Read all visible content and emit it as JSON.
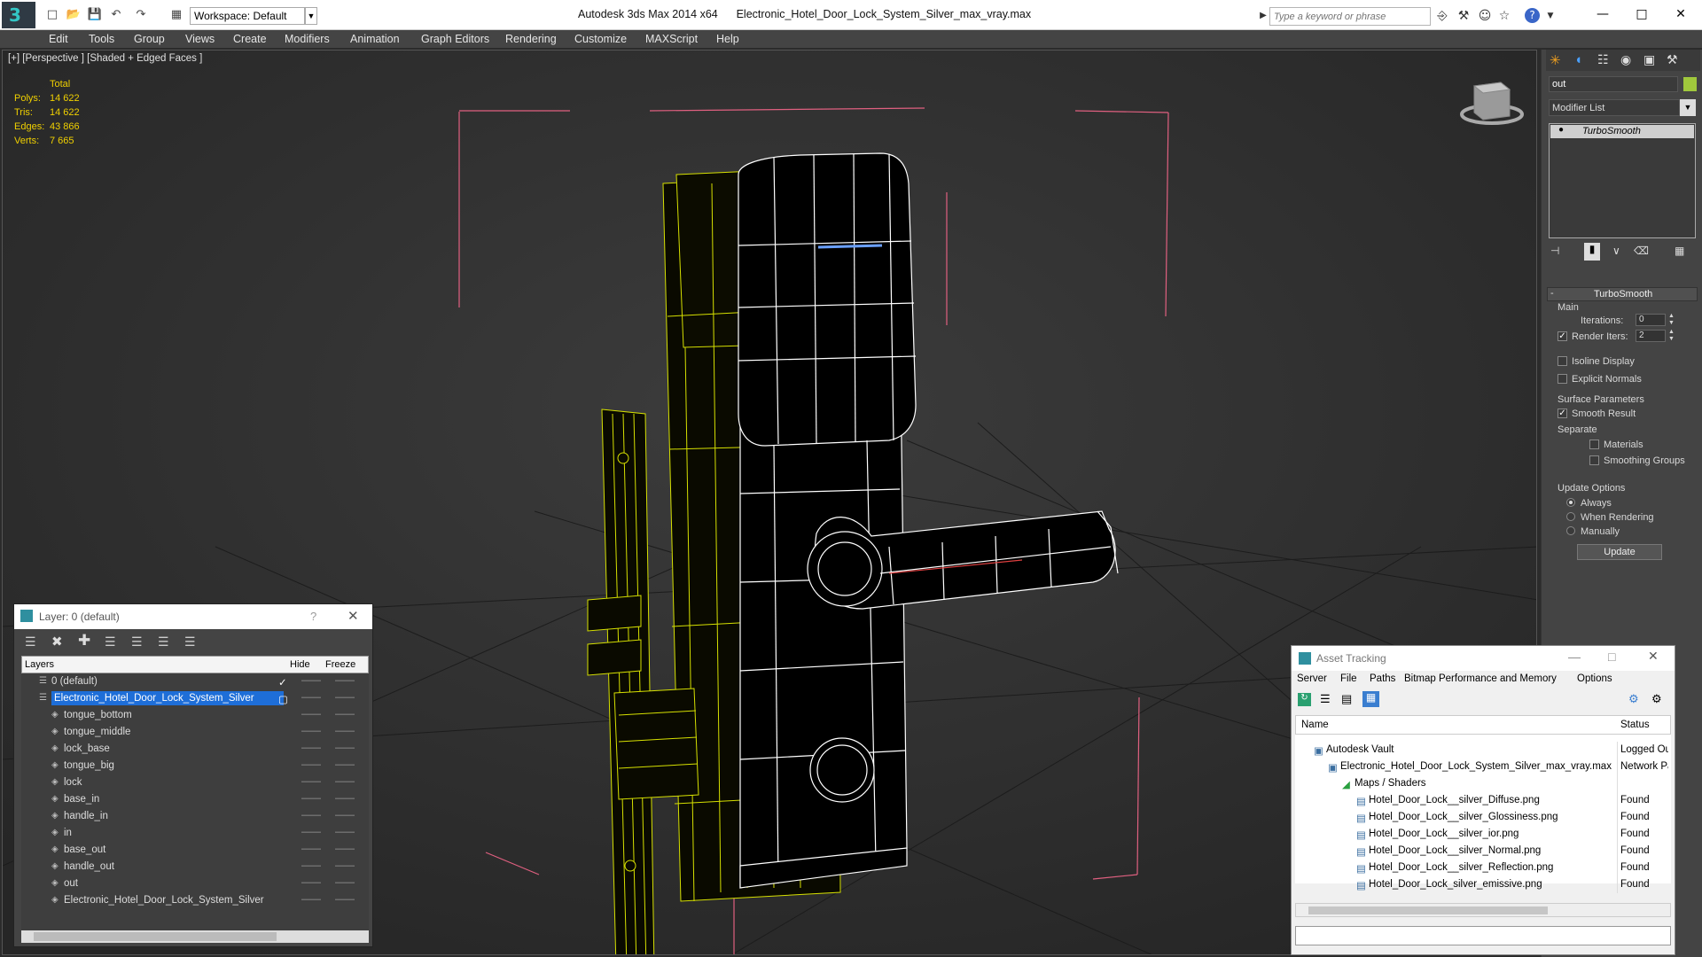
{
  "titlebar": {
    "app_title": "Autodesk 3ds Max  2014 x64",
    "file_title": "Electronic_Hotel_Door_Lock_System_Silver_max_vray.max",
    "workspace_label": "Workspace: Default",
    "search_placeholder": "Type a keyword or phrase",
    "help_label": "?"
  },
  "menubar": [
    "Edit",
    "Tools",
    "Group",
    "Views",
    "Create",
    "Modifiers",
    "Animation",
    "Graph Editors",
    "Rendering",
    "Customize",
    "MAXScript",
    "Help"
  ],
  "viewport": {
    "label": "[+] [Perspective ] [Shaded + Edged Faces ]",
    "stats": {
      "header": "Total",
      "rows": [
        {
          "label": "Polys:",
          "value": "14 622"
        },
        {
          "label": "Tris:",
          "value": "14 622"
        },
        {
          "label": "Edges:",
          "value": "43 866"
        },
        {
          "label": "Verts:",
          "value": "7 665"
        }
      ]
    }
  },
  "command_panel": {
    "object_name": "out",
    "modifier_list_label": "Modifier List",
    "stack_item": "TurboSmooth",
    "rollout_title": "TurboSmooth",
    "main_label": "Main",
    "iterations_label": "Iterations:",
    "iterations_value": "0",
    "render_iters_label": "Render Iters:",
    "render_iters_value": "2",
    "isoline_label": "Isoline Display",
    "explicit_normals_label": "Explicit Normals",
    "surface_params_label": "Surface Parameters",
    "smooth_result_label": "Smooth Result",
    "separate_label": "Separate",
    "materials_label": "Materials",
    "smoothing_groups_label": "Smoothing Groups",
    "update_options_label": "Update Options",
    "always_label": "Always",
    "when_rendering_label": "When Rendering",
    "manually_label": "Manually",
    "update_button": "Update"
  },
  "layer_window": {
    "title": "Layer: 0 (default)",
    "help": "?",
    "columns": {
      "layers": "Layers",
      "hide": "Hide",
      "freeze": "Freeze"
    },
    "rows": [
      {
        "name": "0 (default)",
        "level": 0
      },
      {
        "name": "Electronic_Hotel_Door_Lock_System_Silver",
        "level": 0
      },
      {
        "name": "tongue_bottom",
        "level": 1
      },
      {
        "name": "tongue_middle",
        "level": 1
      },
      {
        "name": "lock_base",
        "level": 1
      },
      {
        "name": "tongue_big",
        "level": 1
      },
      {
        "name": "lock",
        "level": 1
      },
      {
        "name": "base_in",
        "level": 1
      },
      {
        "name": "handle_in",
        "level": 1
      },
      {
        "name": "in",
        "level": 1
      },
      {
        "name": "base_out",
        "level": 1
      },
      {
        "name": "handle_out",
        "level": 1
      },
      {
        "name": "out",
        "level": 1
      },
      {
        "name": "Electronic_Hotel_Door_Lock_System_Silver",
        "level": 1
      }
    ],
    "dash": "——"
  },
  "asset_tracking": {
    "title": "Asset Tracking",
    "menu": [
      "Server",
      "File",
      "Paths",
      "Bitmap Performance and Memory",
      "Options"
    ],
    "columns": {
      "name": "Name",
      "status": "Status"
    },
    "rows": [
      {
        "name": "Autodesk Vault",
        "status": "Logged Out",
        "level": 0
      },
      {
        "name": "Electronic_Hotel_Door_Lock_System_Silver_max_vray.max",
        "status": "Network Path",
        "level": 1
      },
      {
        "name": "Maps / Shaders",
        "status": "",
        "level": 2
      },
      {
        "name": "Hotel_Door_Lock__silver_Diffuse.png",
        "status": "Found",
        "level": 3
      },
      {
        "name": "Hotel_Door_Lock__silver_Glossiness.png",
        "status": "Found",
        "level": 3
      },
      {
        "name": "Hotel_Door_Lock__silver_ior.png",
        "status": "Found",
        "level": 3
      },
      {
        "name": "Hotel_Door_Lock__silver_Normal.png",
        "status": "Found",
        "level": 3
      },
      {
        "name": "Hotel_Door_Lock__silver_Reflection.png",
        "status": "Found",
        "level": 3
      },
      {
        "name": "Hotel_Door_Lock_silver_emissive.png",
        "status": "Found",
        "level": 3
      }
    ]
  },
  "colors": {
    "wire_yellow": "#d6e000",
    "wire_white": "#ffffff",
    "bbox_pink": "#e06080",
    "selected_row": "#1e6ed8",
    "stat_yellow": "#f0d000"
  }
}
